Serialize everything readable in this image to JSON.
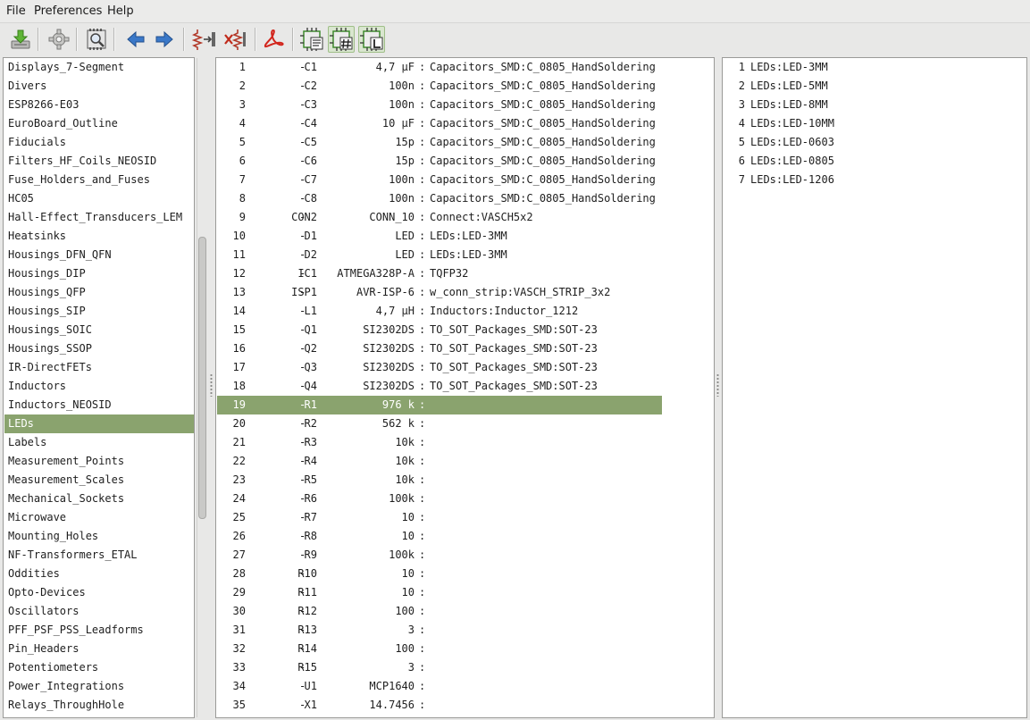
{
  "menu": [
    "File",
    "Preferences",
    "Help"
  ],
  "toolbar": {
    "buttons": [
      {
        "name": "save-netlist",
        "icon": "save-download-icon"
      },
      {
        "name": "config",
        "icon": "gear-icon"
      },
      {
        "name": "view-footprint",
        "icon": "magnifier-chip-icon"
      },
      {
        "name": "previous",
        "icon": "arrow-left-icon"
      },
      {
        "name": "next",
        "icon": "arrow-right-icon"
      },
      {
        "name": "auto-associate",
        "icon": "resistor-associate-icon"
      },
      {
        "name": "delete-associations",
        "icon": "resistor-delete-icon"
      },
      {
        "name": "datasheet",
        "icon": "pdf-icon"
      },
      {
        "name": "filter-by-keywords",
        "icon": "chip-list-icon"
      },
      {
        "name": "filter-by-pin-count",
        "icon": "chip-hash-icon"
      },
      {
        "name": "filter-by-library",
        "icon": "chip-l-icon"
      }
    ],
    "accent": "#3a78c8"
  },
  "libraries": [
    "Displays_7-Segment",
    "Divers",
    "ESP8266-E03",
    "EuroBoard_Outline",
    "Fiducials",
    "Filters_HF_Coils_NEOSID",
    "Fuse_Holders_and_Fuses",
    "HC05",
    "Hall-Effect_Transducers_LEM",
    "Heatsinks",
    "Housings_DFN_QFN",
    "Housings_DIP",
    "Housings_QFP",
    "Housings_SIP",
    "Housings_SOIC",
    "Housings_SSOP",
    "IR-DirectFETs",
    "Inductors",
    "Inductors_NEOSID",
    "LEDs",
    "Labels",
    "Measurement_Points",
    "Measurement_Scales",
    "Mechanical_Sockets",
    "Microwave",
    "Mounting_Holes",
    "NF-Transformers_ETAL",
    "Oddities",
    "Opto-Devices",
    "Oscillators",
    "PFF_PSF_PSS_Leadforms",
    "Pin_Headers",
    "Potentiometers",
    "Power_Integrations",
    "Relays_ThroughHole"
  ],
  "selected_library_index": 19,
  "components": [
    {
      "n": "1",
      "ref": "C1",
      "value": "4,7 µF",
      "fp": "Capacitors_SMD:C_0805_HandSoldering"
    },
    {
      "n": "2",
      "ref": "C2",
      "value": "100n",
      "fp": "Capacitors_SMD:C_0805_HandSoldering"
    },
    {
      "n": "3",
      "ref": "C3",
      "value": "100n",
      "fp": "Capacitors_SMD:C_0805_HandSoldering"
    },
    {
      "n": "4",
      "ref": "C4",
      "value": "10 µF",
      "fp": "Capacitors_SMD:C_0805_HandSoldering"
    },
    {
      "n": "5",
      "ref": "C5",
      "value": "15p",
      "fp": "Capacitors_SMD:C_0805_HandSoldering"
    },
    {
      "n": "6",
      "ref": "C6",
      "value": "15p",
      "fp": "Capacitors_SMD:C_0805_HandSoldering"
    },
    {
      "n": "7",
      "ref": "C7",
      "value": "100n",
      "fp": "Capacitors_SMD:C_0805_HandSoldering"
    },
    {
      "n": "8",
      "ref": "C8",
      "value": "100n",
      "fp": "Capacitors_SMD:C_0805_HandSoldering"
    },
    {
      "n": "9",
      "ref": "CON2",
      "value": "CONN_10",
      "fp": "Connect:VASCH5x2"
    },
    {
      "n": "10",
      "ref": "D1",
      "value": "LED",
      "fp": "LEDs:LED-3MM"
    },
    {
      "n": "11",
      "ref": "D2",
      "value": "LED",
      "fp": "LEDs:LED-3MM"
    },
    {
      "n": "12",
      "ref": "IC1",
      "value": "ATMEGA328P-A",
      "fp": "TQFP32"
    },
    {
      "n": "13",
      "ref": "ISP1",
      "value": "AVR-ISP-6",
      "fp": "w_conn_strip:VASCH_STRIP_3x2"
    },
    {
      "n": "14",
      "ref": "L1",
      "value": "4,7 µH",
      "fp": "Inductors:Inductor_1212"
    },
    {
      "n": "15",
      "ref": "Q1",
      "value": "SI2302DS",
      "fp": "TO_SOT_Packages_SMD:SOT-23"
    },
    {
      "n": "16",
      "ref": "Q2",
      "value": "SI2302DS",
      "fp": "TO_SOT_Packages_SMD:SOT-23"
    },
    {
      "n": "17",
      "ref": "Q3",
      "value": "SI2302DS",
      "fp": "TO_SOT_Packages_SMD:SOT-23"
    },
    {
      "n": "18",
      "ref": "Q4",
      "value": "SI2302DS",
      "fp": "TO_SOT_Packages_SMD:SOT-23"
    },
    {
      "n": "19",
      "ref": "R1",
      "value": "976 k",
      "fp": ""
    },
    {
      "n": "20",
      "ref": "R2",
      "value": "562 k",
      "fp": ""
    },
    {
      "n": "21",
      "ref": "R3",
      "value": "10k",
      "fp": ""
    },
    {
      "n": "22",
      "ref": "R4",
      "value": "10k",
      "fp": ""
    },
    {
      "n": "23",
      "ref": "R5",
      "value": "10k",
      "fp": ""
    },
    {
      "n": "24",
      "ref": "R6",
      "value": "100k",
      "fp": ""
    },
    {
      "n": "25",
      "ref": "R7",
      "value": "10",
      "fp": ""
    },
    {
      "n": "26",
      "ref": "R8",
      "value": "10",
      "fp": ""
    },
    {
      "n": "27",
      "ref": "R9",
      "value": "100k",
      "fp": ""
    },
    {
      "n": "28",
      "ref": "R10",
      "value": "10",
      "fp": ""
    },
    {
      "n": "29",
      "ref": "R11",
      "value": "10",
      "fp": ""
    },
    {
      "n": "30",
      "ref": "R12",
      "value": "100",
      "fp": ""
    },
    {
      "n": "31",
      "ref": "R13",
      "value": "3",
      "fp": ""
    },
    {
      "n": "32",
      "ref": "R14",
      "value": "100",
      "fp": ""
    },
    {
      "n": "33",
      "ref": "R15",
      "value": "3",
      "fp": ""
    },
    {
      "n": "34",
      "ref": "U1",
      "value": "MCP1640",
      "fp": ""
    },
    {
      "n": "35",
      "ref": "X1",
      "value": "14.7456",
      "fp": ""
    }
  ],
  "selected_component_index": 18,
  "footprints": [
    {
      "n": "1",
      "name": "LEDs:LED-3MM"
    },
    {
      "n": "2",
      "name": "LEDs:LED-5MM"
    },
    {
      "n": "3",
      "name": "LEDs:LED-8MM"
    },
    {
      "n": "4",
      "name": "LEDs:LED-10MM"
    },
    {
      "n": "5",
      "name": "LEDs:LED-0603"
    },
    {
      "n": "6",
      "name": "LEDs:LED-0805"
    },
    {
      "n": "7",
      "name": "LEDs:LED-1206"
    }
  ],
  "colors": {
    "selection": "#8aa36e",
    "panel": "#ffffff",
    "border": "#9a9a98"
  }
}
